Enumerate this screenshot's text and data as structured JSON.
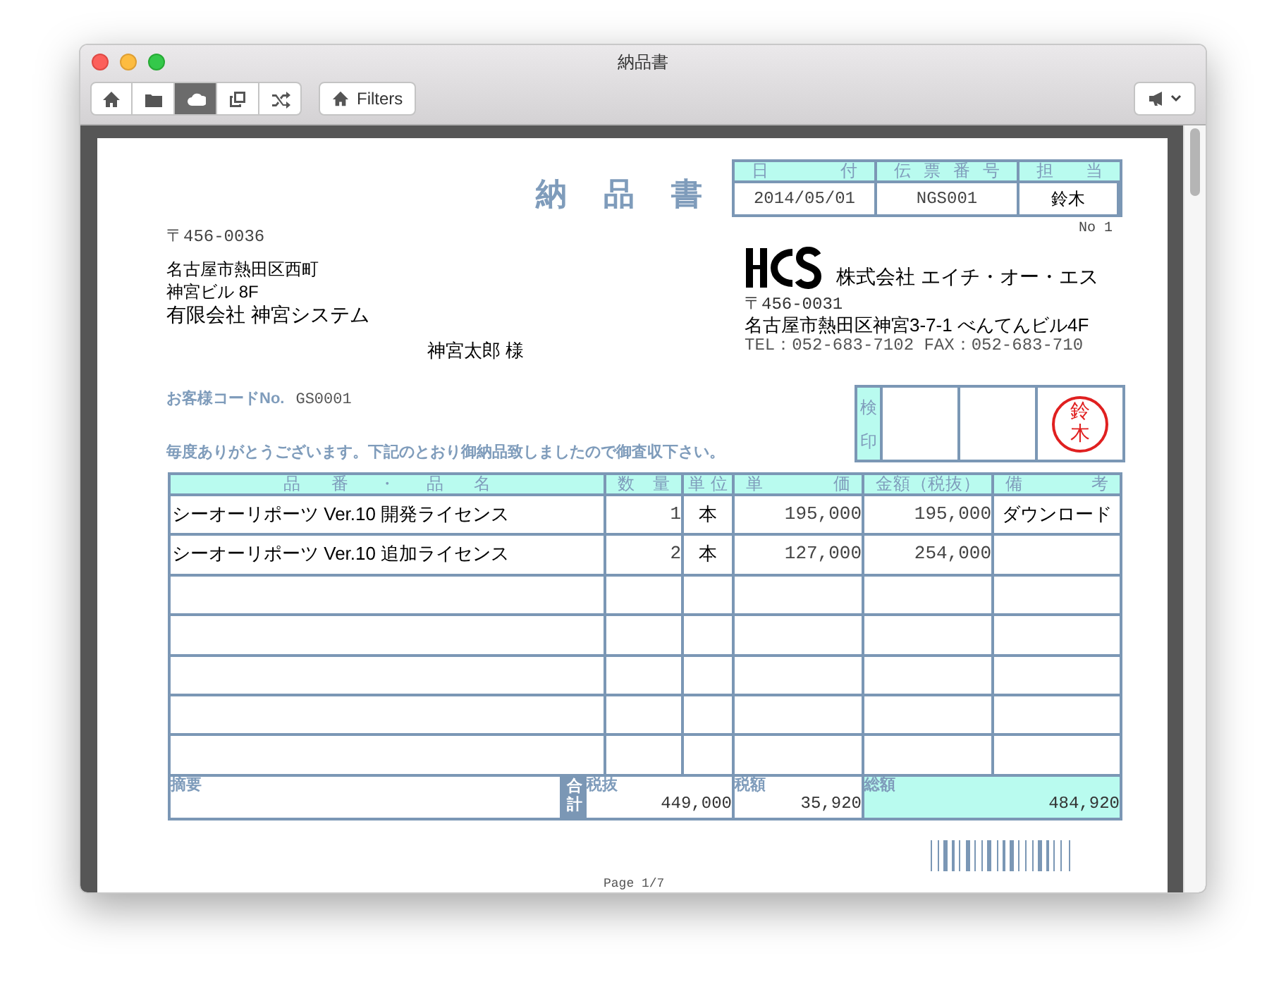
{
  "window": {
    "title": "納品書"
  },
  "toolbar": {
    "view_buttons": [
      {
        "kind": "home",
        "selected": false
      },
      {
        "kind": "folder",
        "selected": false
      },
      {
        "kind": "cloud",
        "selected": true
      },
      {
        "kind": "copy",
        "selected": false
      },
      {
        "kind": "shuffle",
        "selected": false
      }
    ],
    "filters_button": {
      "label": "Filters"
    }
  },
  "document": {
    "title": "納品書",
    "header_table": {
      "columns": [
        "日付",
        "伝票番号",
        "担当"
      ],
      "values": [
        "2014/05/01",
        "NGS001",
        "鈴木"
      ]
    },
    "sheet_number": "No 1",
    "recipient": {
      "postal": "〒456-0036",
      "address_lines": [
        "名古屋市熱田区西町",
        "神宮ビル 8F"
      ],
      "company": "有限会社  神宮システム",
      "person": "神宮太郎 様"
    },
    "sender": {
      "company": "株式会社  エイチ・オー・エス",
      "postal": "〒456-0031",
      "address": "名古屋市熱田区神宮3-7-1  べんてんビル4F",
      "phone": "TEL：052-683-7102 FAX：052-683-710"
    },
    "customer_code": {
      "label": "お客様コードNo.",
      "value": "GS0001"
    },
    "stamp": {
      "label": "検印",
      "seal": "鈴木"
    },
    "message": "毎度ありがとうございます。下記のとおり御納品致しましたので御査収下さい。",
    "items": {
      "columns": [
        "品番・品名",
        "数量",
        "単位",
        "単価",
        "金額（税抜）",
        "備考"
      ],
      "rows": [
        {
          "cells": [
            "シーオーリポーツ Ver.10 開発ライセンス",
            "1",
            "本",
            "195,000",
            "195,000",
            "ダウンロード"
          ]
        },
        {
          "cells": [
            "シーオーリポーツ Ver.10 追加ライセンス",
            "2",
            "本",
            "127,000",
            "254,000"
          ]
        },
        {
          "cells": []
        },
        {
          "cells": []
        },
        {
          "cells": []
        },
        {
          "cells": []
        },
        {
          "cells": []
        }
      ]
    },
    "totals": {
      "remarks_label": "摘要",
      "total_label": "合計",
      "subtotal": {
        "label": "税抜",
        "value": "449,000"
      },
      "tax": {
        "label": "税額",
        "value": "35,920"
      },
      "grand_total": {
        "label": "総額",
        "value": "484,920"
      }
    },
    "page_indicator": "Page 1/7"
  }
}
